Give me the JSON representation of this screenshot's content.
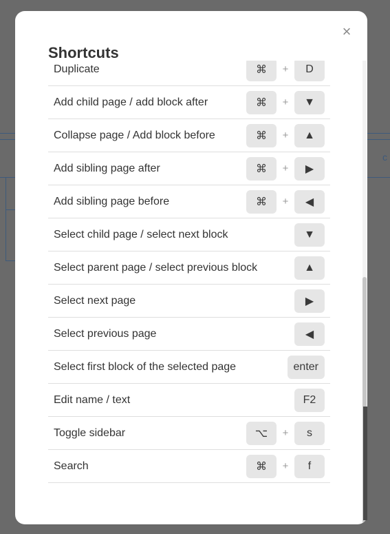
{
  "modal": {
    "title": "Shortcuts",
    "close_label": "×"
  },
  "background": {
    "partial_label": "c"
  },
  "shortcuts": [
    {
      "label": "Duplicate",
      "keys": [
        "⌘",
        "D"
      ]
    },
    {
      "label": "Add child page / add block after",
      "keys": [
        "⌘",
        "▼"
      ]
    },
    {
      "label": "Collapse page / Add block before",
      "keys": [
        "⌘",
        "▲"
      ]
    },
    {
      "label": "Add sibling page after",
      "keys": [
        "⌘",
        "▶"
      ]
    },
    {
      "label": "Add sibling page before",
      "keys": [
        "⌘",
        "◀"
      ]
    },
    {
      "label": "Select child page / select next block",
      "keys": [
        "▼"
      ]
    },
    {
      "label": "Select parent page / select previous block",
      "keys": [
        "▲"
      ]
    },
    {
      "label": "Select next page",
      "keys": [
        "▶"
      ]
    },
    {
      "label": "Select previous page",
      "keys": [
        "◀"
      ]
    },
    {
      "label": "Select first block of the selected page",
      "keys": [
        "enter"
      ]
    },
    {
      "label": "Edit name / text",
      "keys": [
        "F2"
      ]
    },
    {
      "label": "Toggle sidebar",
      "keys": [
        "⌥",
        "s"
      ]
    },
    {
      "label": "Search",
      "keys": [
        "⌘",
        "f"
      ]
    }
  ],
  "key_separator": "+",
  "colors": {
    "overlay": "#6a6a6a",
    "modal_bg": "#ffffff",
    "key_bg": "#e6e6e6",
    "divider": "#dedede",
    "text": "#333333",
    "bg_accent": "#3d5a7c"
  }
}
